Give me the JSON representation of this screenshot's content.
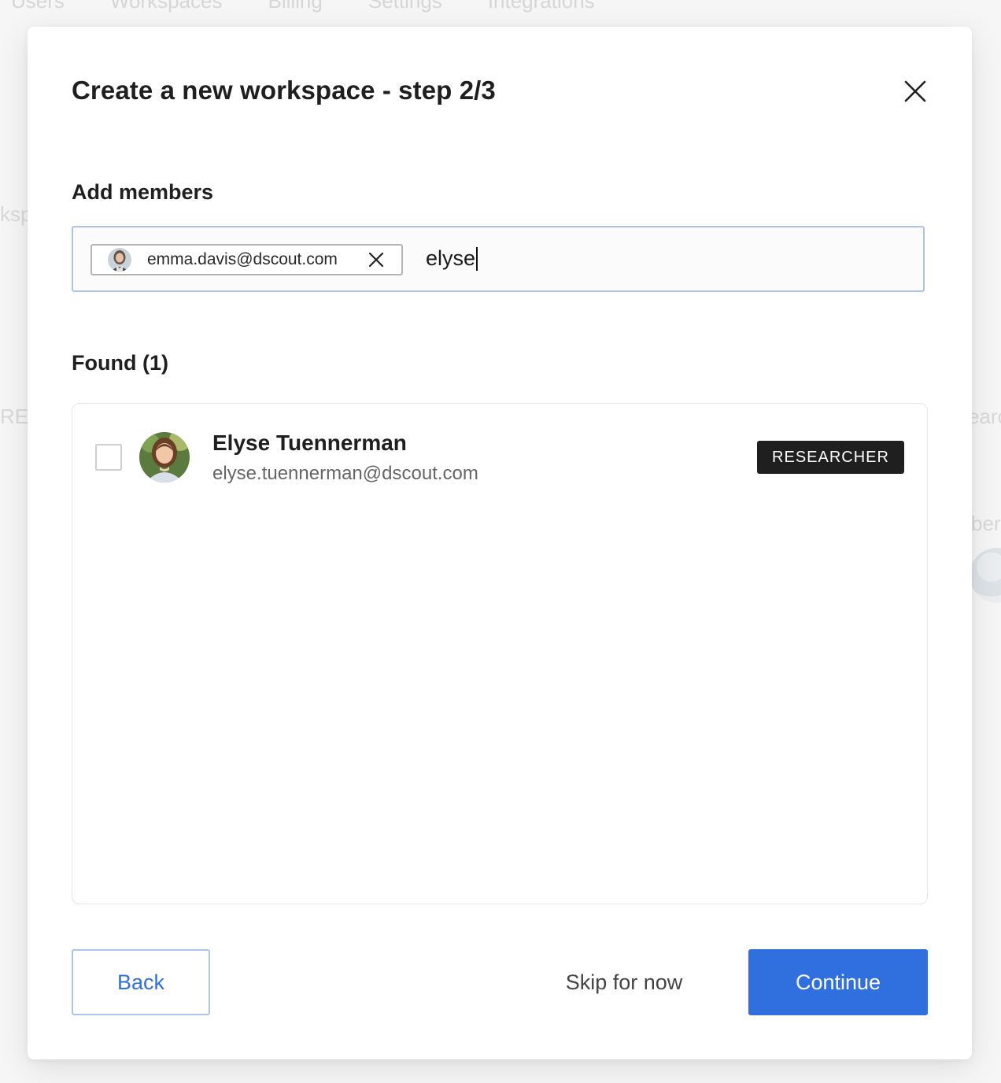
{
  "background": {
    "nav_items": [
      "Users",
      "Workspaces",
      "Billing",
      "Settings",
      "Integrations"
    ],
    "fragments": [
      "ksp",
      "RES",
      "earc",
      "ber"
    ]
  },
  "modal": {
    "title": "Create a new workspace - step 2/3",
    "close_icon": "close-icon"
  },
  "members": {
    "label": "Add members",
    "selected": [
      {
        "email": "emma.davis@dscout.com",
        "avatar": "avatar-photo",
        "remove_icon": "close-icon"
      }
    ],
    "query": "elyse"
  },
  "found": {
    "label": "Found (1)",
    "results": [
      {
        "name": "Elyse Tuennerman",
        "email": "elyse.tuennerman@dscout.com",
        "role": "RESEARCHER",
        "checked": false
      }
    ]
  },
  "footer": {
    "back_label": "Back",
    "skip_label": "Skip for now",
    "continue_label": "Continue"
  },
  "colors": {
    "accent": "#2f6fde",
    "input_border": "#a9c6ea",
    "badge_bg": "#1f1f1f"
  }
}
